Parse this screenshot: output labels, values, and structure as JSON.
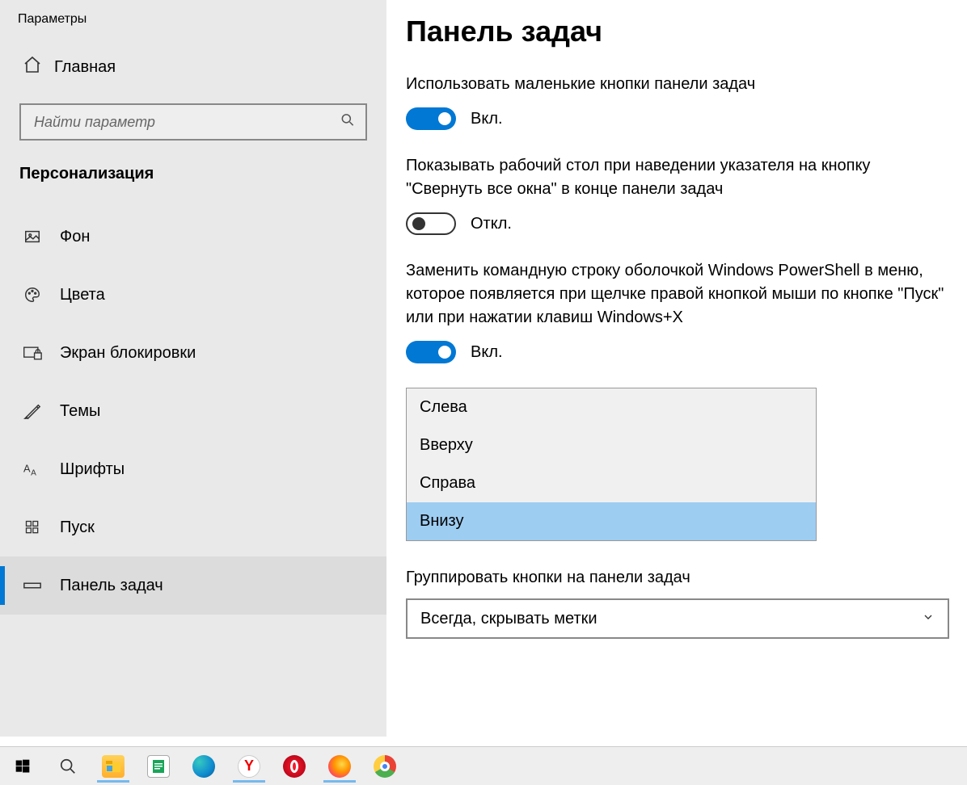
{
  "app_title": "Параметры",
  "home_label": "Главная",
  "search_placeholder": "Найти параметр",
  "category": "Персонализация",
  "nav": [
    {
      "label": "Фон"
    },
    {
      "label": "Цвета"
    },
    {
      "label": "Экран блокировки"
    },
    {
      "label": "Темы"
    },
    {
      "label": "Шрифты"
    },
    {
      "label": "Пуск"
    },
    {
      "label": "Панель задач"
    }
  ],
  "page_title": "Панель задач",
  "settings": {
    "small_buttons": {
      "label": "Использовать маленькие кнопки панели задач",
      "state": "Вкл."
    },
    "peek_desktop": {
      "label": "Показывать рабочий стол при наведении указателя на кнопку \"Свернуть все окна\" в конце панели задач",
      "state": "Откл."
    },
    "powershell": {
      "label": "Заменить командную строку оболочкой Windows PowerShell в меню, которое появляется при щелчке правой кнопкой мыши по кнопке \"Пуск\" или при нажатии клавиш Windows+X",
      "state": "Вкл."
    }
  },
  "position_options": [
    "Слева",
    "Вверху",
    "Справа",
    "Внизу"
  ],
  "position_selected_index": 3,
  "group_label": "Группировать кнопки на панели задач",
  "group_value": "Всегда, скрывать метки",
  "taskbar_items": [
    {
      "name": "start",
      "color": "#000"
    },
    {
      "name": "search",
      "color": "transparent"
    },
    {
      "name": "file-explorer",
      "color": "#ffcc30",
      "active": true
    },
    {
      "name": "libreoffice",
      "color": "#18a558"
    },
    {
      "name": "edge",
      "color": "#0f8bd0"
    },
    {
      "name": "yandex",
      "color": "#ffffff",
      "active": true
    },
    {
      "name": "opera",
      "color": "#ff1b2d"
    },
    {
      "name": "firefox",
      "color": "#ff9500",
      "active": true
    },
    {
      "name": "chrome",
      "color": "#ffffff"
    }
  ]
}
